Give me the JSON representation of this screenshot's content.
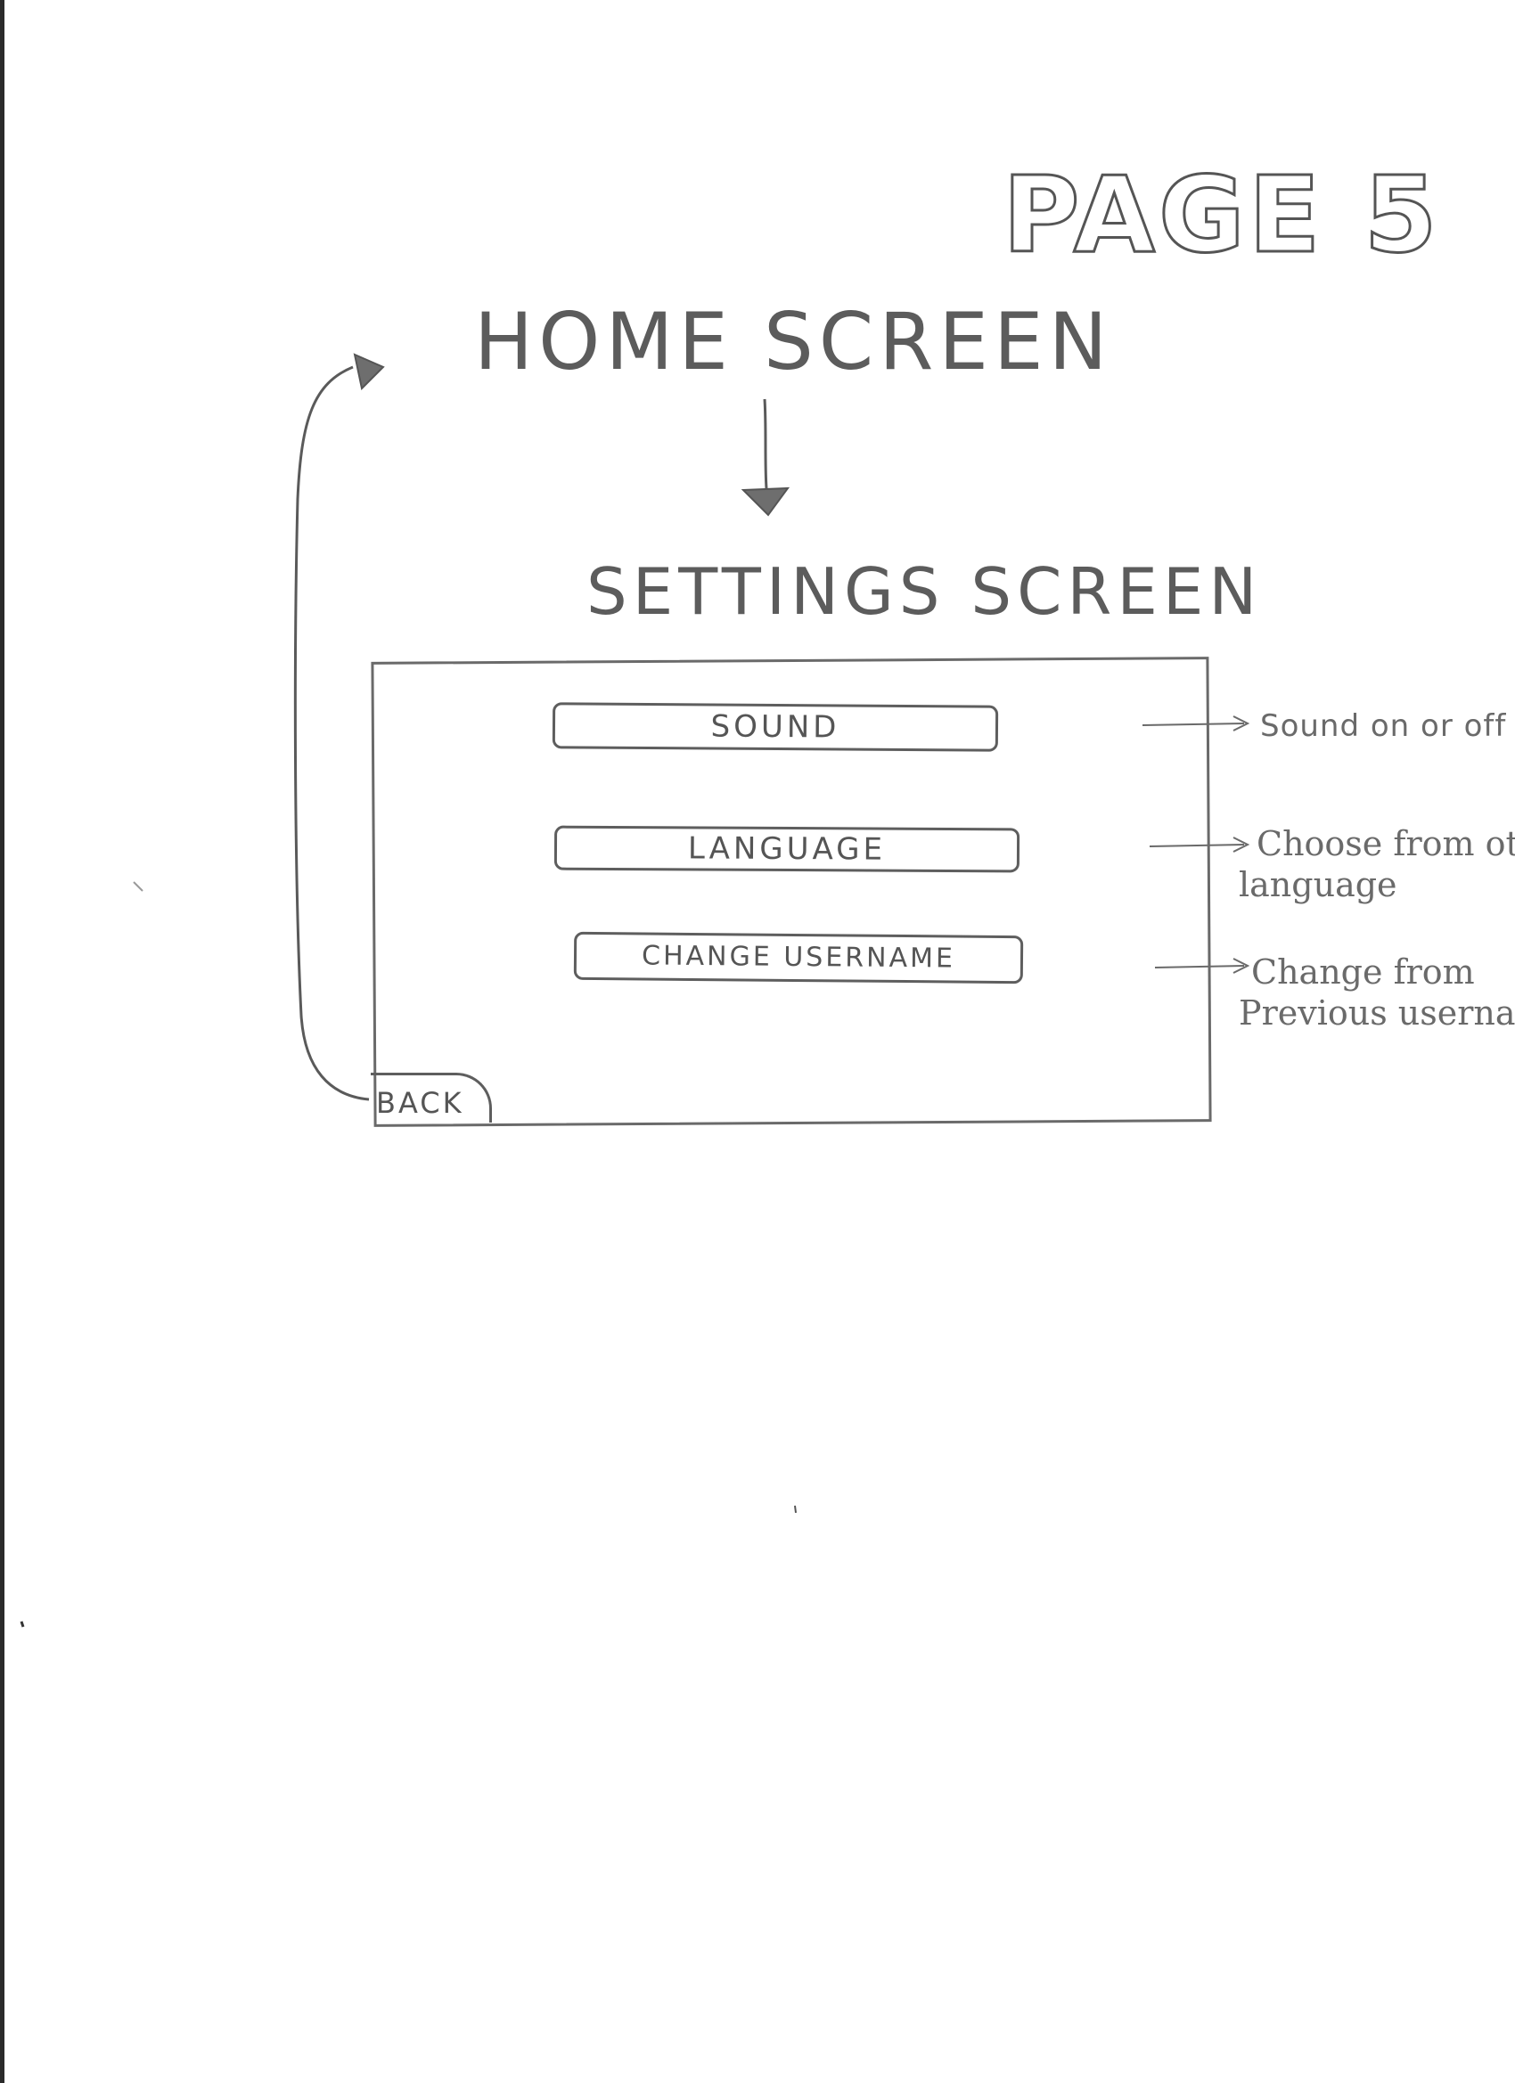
{
  "page_label": "PAGE 5",
  "home_screen": {
    "title": "HOME SCREEN"
  },
  "settings_screen": {
    "title": "SETTINGS SCREEN",
    "buttons": [
      {
        "label": "SOUND",
        "note": [
          "Sound on or off"
        ]
      },
      {
        "label": "LANGUAGE",
        "note": [
          "Choose from othe",
          "language"
        ]
      },
      {
        "label": "CHANGE USERNAME",
        "note": [
          "Change from",
          "Previous usernam"
        ]
      }
    ],
    "back_label": "BACK"
  },
  "colors": {
    "pencil": "#5a5a5a",
    "paper": "#ffffff"
  }
}
